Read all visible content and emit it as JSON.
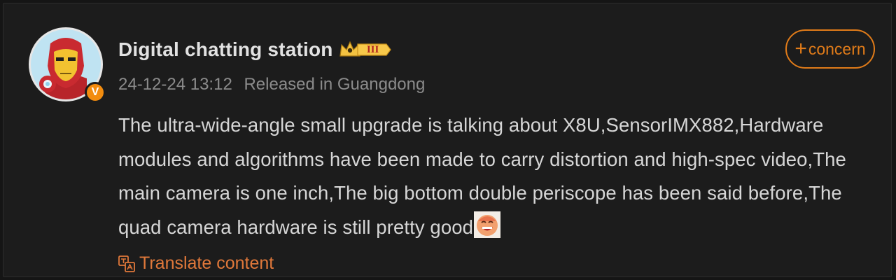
{
  "post": {
    "author": {
      "name": "Digital chatting station",
      "avatar_icon": "ironman-avatar-icon",
      "verified_badge": "V",
      "rank_badge": {
        "icon": "crown-icon",
        "level": "III"
      }
    },
    "timestamp": "24-12-24 13:12",
    "location": "Released in Guangdong",
    "content": "The ultra-wide-angle small upgrade is talking about X8U,SensorIMX882,Hardware modules and algorithms have been made to carry distortion and high-spec video,The main camera is one inch,The big bottom double periscope has been said before,The quad camera hardware is still pretty good",
    "emoji": "laughing-emoji-icon",
    "follow_button": {
      "plus": "+",
      "label": "concern"
    },
    "translate": {
      "icon": "translate-icon",
      "label": "Translate content"
    }
  },
  "colors": {
    "background": "#1c1c1c",
    "accent": "#e07b19",
    "verified": "#f28c0f",
    "text_primary": "#e2e2e2",
    "text_secondary": "#8b8b8b"
  }
}
